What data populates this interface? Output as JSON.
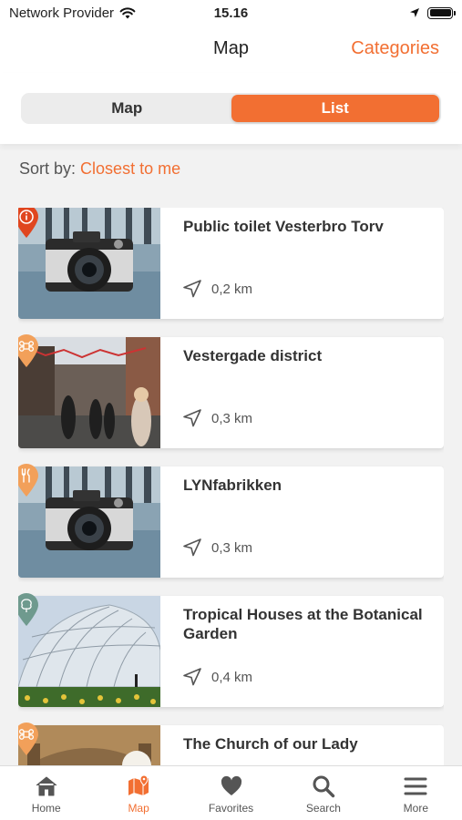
{
  "status": {
    "carrier": "Network Provider",
    "time": "15.16"
  },
  "nav": {
    "title": "Map",
    "right_action": "Categories"
  },
  "segmented": {
    "options": [
      "Map",
      "List"
    ],
    "selected": "List"
  },
  "sort": {
    "label": "Sort by:",
    "value": "Closest to me"
  },
  "places": [
    {
      "title": "Public toilet Vesterbro Torv",
      "distance": "0,2 km",
      "icon": "info-icon",
      "pin_color": "#e0461f",
      "image": "camera-photo"
    },
    {
      "title": "Vestergade district",
      "distance": "0,3 km",
      "icon": "command-icon",
      "pin_color": "#f2a05a",
      "image": "street-photo"
    },
    {
      "title": "LYNfabrikken",
      "distance": "0,3 km",
      "icon": "fork-knife-icon",
      "pin_color": "#f2a05a",
      "image": "camera-photo"
    },
    {
      "title": "Tropical Houses at the Botanical Garden",
      "distance": "0,4 km",
      "icon": "tree-icon",
      "pin_color": "#6f9a8e",
      "image": "greenhouse-photo"
    },
    {
      "title": "The Church of our Lady",
      "distance": "",
      "icon": "command-icon",
      "pin_color": "#f2a05a",
      "image": "church-photo"
    }
  ],
  "tabs": [
    {
      "label": "Home",
      "icon": "home-icon"
    },
    {
      "label": "Map",
      "icon": "map-icon"
    },
    {
      "label": "Favorites",
      "icon": "heart-icon"
    },
    {
      "label": "Search",
      "icon": "search-icon"
    },
    {
      "label": "More",
      "icon": "menu-icon"
    }
  ],
  "colors": {
    "accent": "#f26f32",
    "tab_inactive": "#555555",
    "background": "#f2f2f2"
  }
}
